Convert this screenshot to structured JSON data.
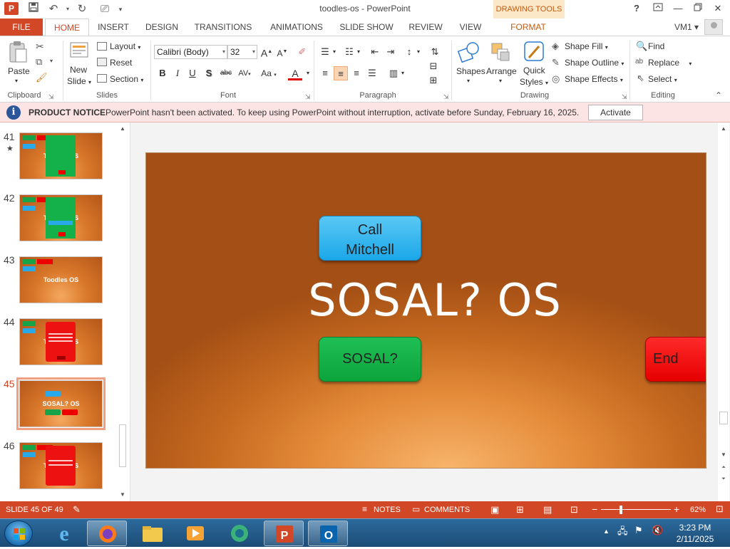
{
  "window": {
    "title": "toodles-os - PowerPoint",
    "contextual_tab_header": "DRAWING TOOLS",
    "help": "?",
    "app_icon_letter": "P"
  },
  "tabs": [
    "FILE",
    "HOME",
    "INSERT",
    "DESIGN",
    "TRANSITIONS",
    "ANIMATIONS",
    "SLIDE SHOW",
    "REVIEW",
    "VIEW",
    "FORMAT"
  ],
  "user": {
    "name": "VM1"
  },
  "ribbon": {
    "clipboard": {
      "label": "Clipboard",
      "paste": "Paste"
    },
    "slides": {
      "label": "Slides",
      "new_slide_1": "New",
      "new_slide_2": "Slide",
      "layout": "Layout",
      "reset": "Reset",
      "section": "Section"
    },
    "font": {
      "label": "Font",
      "font_name": "Calibri (Body)",
      "font_size": "32",
      "bold": "B",
      "italic": "I",
      "underline": "U",
      "shadow": "S",
      "strike": "abc",
      "spacing": "AV",
      "case": "Aa",
      "color": "A"
    },
    "paragraph": {
      "label": "Paragraph"
    },
    "drawing": {
      "label": "Drawing",
      "shapes": "Shapes",
      "arrange": "Arrange",
      "quick_styles_1": "Quick",
      "quick_styles_2": "Styles",
      "shape_fill": "Shape Fill",
      "shape_outline": "Shape Outline",
      "shape_effects": "Shape Effects"
    },
    "editing": {
      "label": "Editing",
      "find": "Find",
      "replace": "Replace",
      "select": "Select"
    }
  },
  "notice": {
    "label": "PRODUCT NOTICE",
    "message": "PowerPoint hasn't been activated. To keep using PowerPoint without interruption, activate before Sunday, February 16, 2025.",
    "button": "Activate"
  },
  "thumbnails": [
    {
      "number": "41",
      "starred": true,
      "text": "Toodles OS"
    },
    {
      "number": "42",
      "starred": false,
      "text": "Toodles OS"
    },
    {
      "number": "43",
      "starred": false,
      "text": "Toodles OS"
    },
    {
      "number": "44",
      "starred": false,
      "text": "Toodles OS"
    },
    {
      "number": "45",
      "starred": false,
      "text": "SOSAL? OS",
      "selected": true
    },
    {
      "number": "46",
      "starred": false,
      "text": "Toodles OS"
    }
  ],
  "slide": {
    "title": "SOSAL? OS",
    "call_button_line1": "Call",
    "call_button_line2": "Mitchell",
    "sosal_button": "SOSAL?",
    "end_button": "End"
  },
  "status": {
    "slide_indicator": "SLIDE 45 OF 49",
    "notes": "NOTES",
    "comments": "COMMENTS",
    "zoom": "62%",
    "zoom_level": 0.62
  },
  "taskbar": {
    "time": "3:23 PM",
    "date": "2/11/2025"
  },
  "colors": {
    "accent": "#d24726",
    "call_button": "#1ba7e8",
    "sosal_button": "#0da43d",
    "end_button": "#e60000"
  }
}
